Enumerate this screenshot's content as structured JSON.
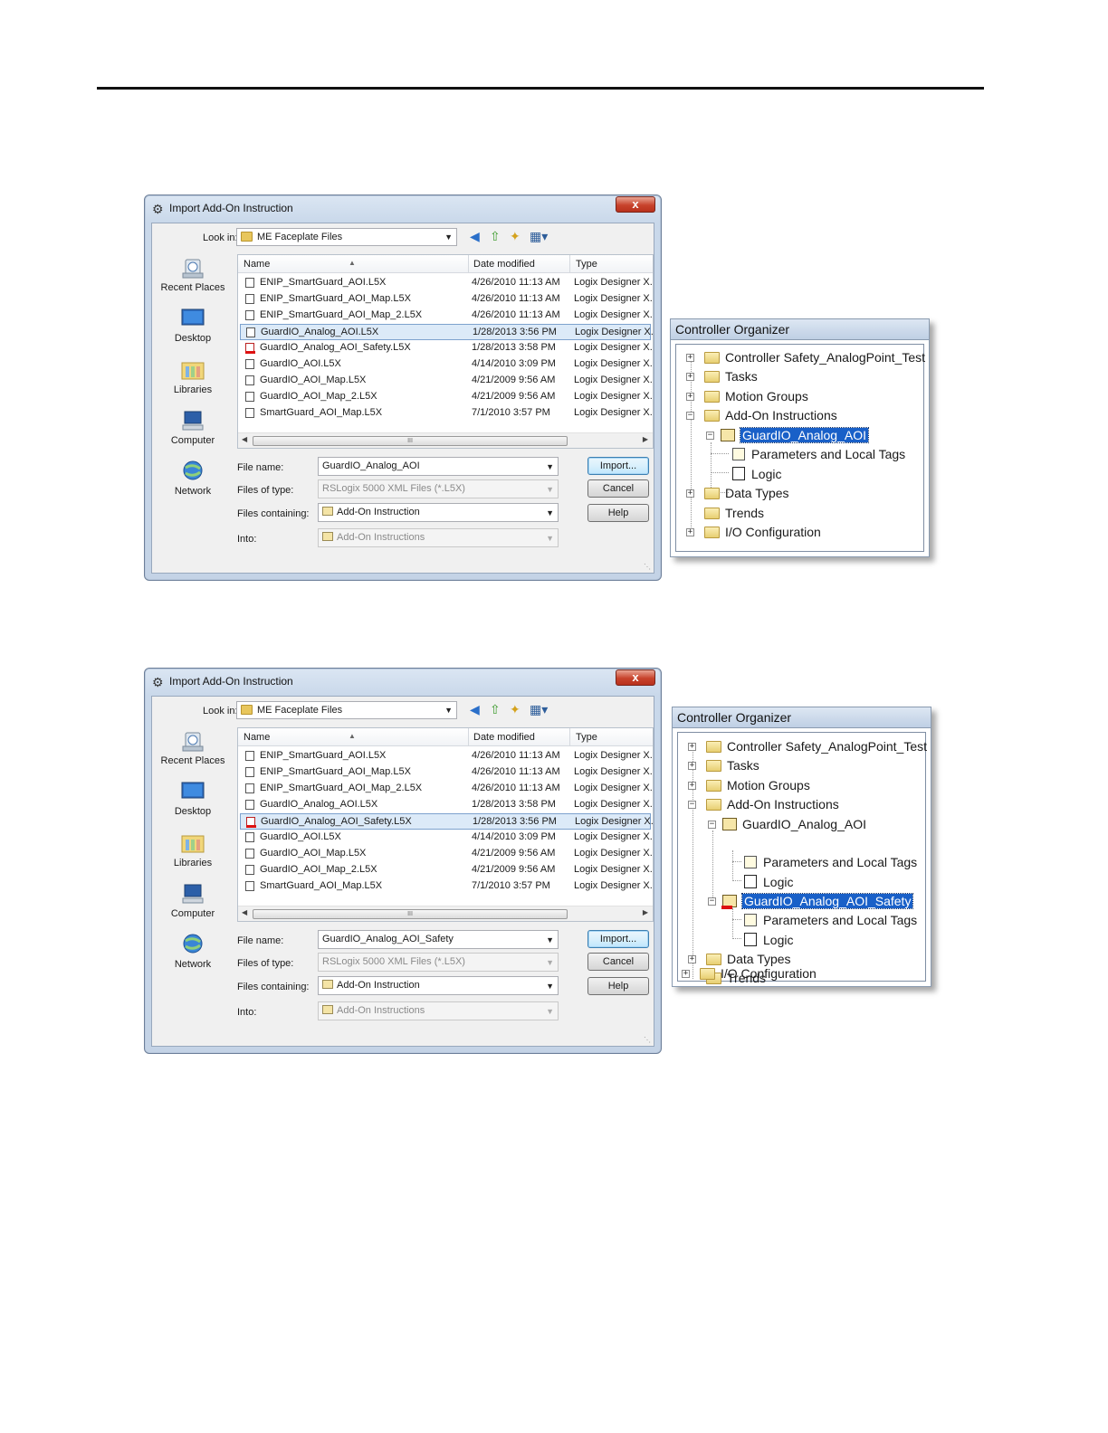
{
  "dialog": {
    "title": "Import Add-On Instruction",
    "close_label": "x",
    "look_in_label": "Look in:",
    "look_in_value": "ME Faceplate Files",
    "places": [
      "Recent Places",
      "Desktop",
      "Libraries",
      "Computer",
      "Network"
    ],
    "columns": [
      "Name",
      "Date modified",
      "Type"
    ],
    "scroll_grip": "III",
    "file_name_label": "File name:",
    "files_of_type_label": "Files of type:",
    "files_of_type_value": "RSLogix 5000 XML Files (*.L5X)",
    "files_containing_label": "Files containing:",
    "files_containing_value": "Add-On Instruction",
    "into_label": "Into:",
    "into_value": "Add-On Instructions",
    "import_label": "Import...",
    "cancel_label": "Cancel",
    "help_label": "Help"
  },
  "dialog1": {
    "file_name_value": "GuardIO_Analog_AOI",
    "files": [
      {
        "name": "ENIP_SmartGuard_AOI.L5X",
        "date": "4/26/2010 11:13 AM",
        "type": "Logix Designer X.",
        "red": false,
        "selected": false
      },
      {
        "name": "ENIP_SmartGuard_AOI_Map.L5X",
        "date": "4/26/2010 11:13 AM",
        "type": "Logix Designer X.",
        "red": false,
        "selected": false
      },
      {
        "name": "ENIP_SmartGuard_AOI_Map_2.L5X",
        "date": "4/26/2010 11:13 AM",
        "type": "Logix Designer X.",
        "red": false,
        "selected": false
      },
      {
        "name": "GuardIO_Analog_AOI.L5X",
        "date": "1/28/2013 3:56 PM",
        "type": "Logix Designer X.",
        "red": false,
        "selected": true
      },
      {
        "name": "GuardIO_Analog_AOI_Safety.L5X",
        "date": "1/28/2013 3:58 PM",
        "type": "Logix Designer X.",
        "red": true,
        "selected": false
      },
      {
        "name": "GuardIO_AOI.L5X",
        "date": "4/14/2010 3:09 PM",
        "type": "Logix Designer X.",
        "red": false,
        "selected": false
      },
      {
        "name": "GuardIO_AOI_Map.L5X",
        "date": "4/21/2009 9:56 AM",
        "type": "Logix Designer X.",
        "red": false,
        "selected": false
      },
      {
        "name": "GuardIO_AOI_Map_2.L5X",
        "date": "4/21/2009 9:56 AM",
        "type": "Logix Designer X.",
        "red": false,
        "selected": false
      },
      {
        "name": "SmartGuard_AOI_Map.L5X",
        "date": "7/1/2010 3:57 PM",
        "type": "Logix Designer X.",
        "red": false,
        "selected": false
      }
    ]
  },
  "dialog2": {
    "file_name_value": "GuardIO_Analog_AOI_Safety",
    "files": [
      {
        "name": "ENIP_SmartGuard_AOI.L5X",
        "date": "4/26/2010 11:13 AM",
        "type": "Logix Designer X.",
        "red": false,
        "selected": false
      },
      {
        "name": "ENIP_SmartGuard_AOI_Map.L5X",
        "date": "4/26/2010 11:13 AM",
        "type": "Logix Designer X.",
        "red": false,
        "selected": false
      },
      {
        "name": "ENIP_SmartGuard_AOI_Map_2.L5X",
        "date": "4/26/2010 11:13 AM",
        "type": "Logix Designer X.",
        "red": false,
        "selected": false
      },
      {
        "name": "GuardIO_Analog_AOI.L5X",
        "date": "1/28/2013 3:58 PM",
        "type": "Logix Designer X.",
        "red": false,
        "selected": false
      },
      {
        "name": "GuardIO_Analog_AOI_Safety.L5X",
        "date": "1/28/2013 3:56 PM",
        "type": "Logix Designer X.",
        "red": true,
        "selected": true
      },
      {
        "name": "GuardIO_AOI.L5X",
        "date": "4/14/2010 3:09 PM",
        "type": "Logix Designer X.",
        "red": false,
        "selected": false
      },
      {
        "name": "GuardIO_AOI_Map.L5X",
        "date": "4/21/2009 9:56 AM",
        "type": "Logix Designer X.",
        "red": false,
        "selected": false
      },
      {
        "name": "GuardIO_AOI_Map_2.L5X",
        "date": "4/21/2009 9:56 AM",
        "type": "Logix Designer X.",
        "red": false,
        "selected": false
      },
      {
        "name": "SmartGuard_AOI_Map.L5X",
        "date": "7/1/2010 3:57 PM",
        "type": "Logix Designer X.",
        "red": false,
        "selected": false
      }
    ]
  },
  "organizer": {
    "title": "Controller Organizer",
    "controller": "Controller Safety_AnalogPoint_Test",
    "tasks": "Tasks",
    "motion_groups": "Motion Groups",
    "add_on_instructions": "Add-On Instructions",
    "aoi_1": "GuardIO_Analog_AOI",
    "aoi_2": "GuardIO_Analog_AOI_Safety",
    "params": "Parameters and Local Tags",
    "logic": "Logic",
    "data_types": "Data Types",
    "trends": "Trends",
    "io_config": "I/O Configuration",
    "expand_glyph": "+",
    "collapse_glyph": "−"
  }
}
